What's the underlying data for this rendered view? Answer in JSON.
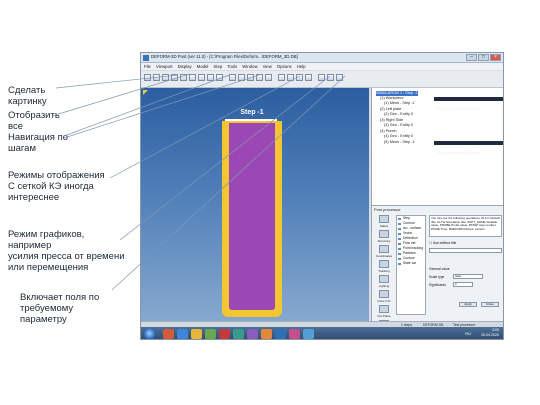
{
  "captions": [
    {
      "id": "take-picture",
      "text": "Сделать\nкартинку"
    },
    {
      "id": "show-all",
      "text": "Отобразить\nвсе"
    },
    {
      "id": "step-navigation",
      "text": "Навигация по\nшагам"
    },
    {
      "id": "display-modes",
      "text": "Режимы отображения\nС сеткой КЭ иногда\nинтереснее"
    },
    {
      "id": "graph-mode",
      "text": "Режим графиков,\nнапример\nусилия пресса от времени\nили перемещения"
    },
    {
      "id": "field-enable",
      "text": "Включает поля по\nтребуемому\nпараметру"
    }
  ],
  "app": {
    "title": "DEFORM-3D Post (ver 11.0) - [C:\\Program Files\\Deform...\\DEFORM_3D.DB]",
    "menu": [
      "File",
      "Viewport",
      "Display",
      "Model",
      "Step",
      "Tools",
      "Window",
      "View",
      "Options",
      "Help"
    ],
    "viewport": {
      "step_label": "Step -1"
    },
    "tree": [
      {
        "text": "SIMULATION 1 : Step -1",
        "selected": true
      },
      {
        "text": "(1) Workpiece",
        "selected": false
      },
      {
        "text": "(1) Mesh - Step -1",
        "selected": false
      },
      {
        "text": "(2) Left plate",
        "selected": false
      },
      {
        "text": "(2) Geo - Entity 0",
        "selected": false
      },
      {
        "text": "(3) Right Side",
        "selected": false
      },
      {
        "text": "(3) Geo - Entity 0",
        "selected": false
      },
      {
        "text": "(4) Punch",
        "selected": false
      },
      {
        "text": "(4) Geo - Entity 0",
        "selected": false
      },
      {
        "text": "(5) Mesh - Step -1",
        "selected": false
      }
    ],
    "material_tag": "ALUMINUM-H3004(BGR-BMS)",
    "properties": {
      "header": "Post processor",
      "icons": [
        "Status",
        "Summary",
        "Coordinates",
        "Tracking",
        "Lighting",
        "Color Info",
        "Cut Plane",
        "Edit Cut"
      ],
      "list": [
        "Step",
        "Contour",
        "Iso - surface",
        "Vector",
        "Deflection",
        "Flow net",
        "Point tracking",
        "Particles",
        "Contour",
        "State var"
      ],
      "description": "You can use the following operations: ALT-C Default title, ALT-E Simulation title, #OPT_NAME Variable value, PROBE Probe value, #STEP step number, #TIME Time, #DEFORM Deform version",
      "checkbox_label": "Use editbox title",
      "general_label": "General value",
      "scale_label": "Scale type",
      "scale_value": "Auto",
      "digits_label": "Significants",
      "digits_value": "2",
      "apply_label": "Apply",
      "close_label": "Close"
    },
    "status": {
      "left": "1 steps",
      "middle": "DEFORM DB",
      "right": "Test processor"
    },
    "tray": {
      "lang": "RU",
      "time": "3:00",
      "date": "25.04.2020"
    }
  }
}
